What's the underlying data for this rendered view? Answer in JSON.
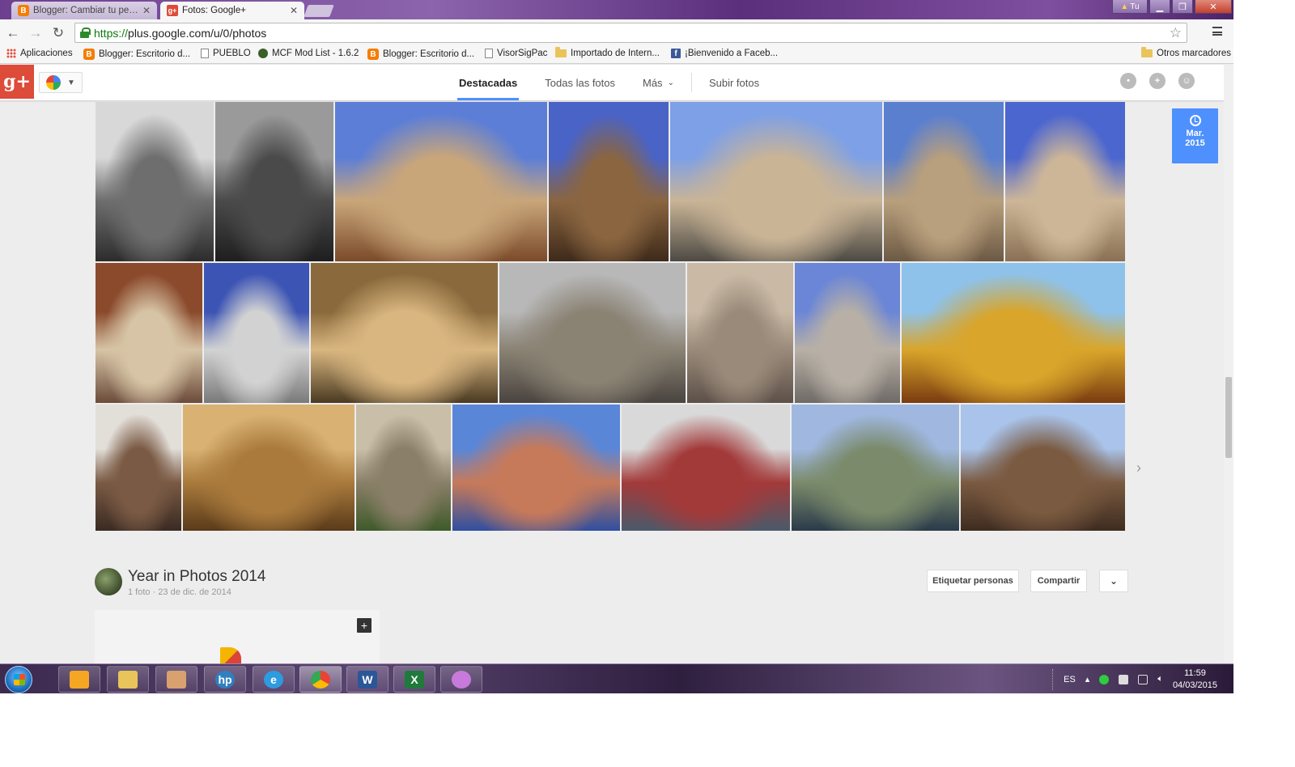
{
  "browser": {
    "tabs": [
      {
        "title": "Blogger: Cambiar tu perfil",
        "icon": "blogger-icon",
        "active": false
      },
      {
        "title": "Fotos: Google+",
        "icon": "google-plus-icon",
        "active": true
      }
    ],
    "window_user_label": "Tu",
    "url_scheme": "https://",
    "url_rest": "plus.google.com/u/0/photos",
    "bookmarks": [
      {
        "label": "Aplicaciones",
        "icon": "apps-icon"
      },
      {
        "label": "Blogger: Escritorio d...",
        "icon": "blogger-icon"
      },
      {
        "label": "PUEBLO",
        "icon": "page-icon"
      },
      {
        "label": "MCF Mod List - 1.6.2",
        "icon": "mcf-icon"
      },
      {
        "label": "Blogger: Escritorio d...",
        "icon": "blogger-icon"
      },
      {
        "label": "VisorSigPac",
        "icon": "page-icon"
      },
      {
        "label": "Importado de Intern...",
        "icon": "folder-icon"
      },
      {
        "label": "¡Bienvenido a Faceb...",
        "icon": "facebook-icon"
      }
    ],
    "other_bookmarks": "Otros marcadores"
  },
  "gplus": {
    "logo": "g+",
    "nav": [
      "Destacadas",
      "Todas las fotos",
      "Más"
    ],
    "upload": "Subir fotos",
    "selected_nav": "Destacadas"
  },
  "date_badge": {
    "month": "Mar.",
    "year": "2015"
  },
  "photos": [
    {
      "subject": "stone column",
      "colors": [
        "#d8d8d8",
        "#6e6e6e",
        "#2c2c2c"
      ]
    },
    {
      "subject": "church tower bw",
      "colors": [
        "#9a9a9a",
        "#4a4a4a",
        "#1e1e1e"
      ]
    },
    {
      "subject": "town hall clock",
      "colors": [
        "#5d7ed6",
        "#c9a67a",
        "#7b4a2a"
      ]
    },
    {
      "subject": "bell tower",
      "colors": [
        "#4a63c7",
        "#8a6540",
        "#3e2a1a"
      ]
    },
    {
      "subject": "church plaza",
      "colors": [
        "#7ea0e6",
        "#c9b496",
        "#4d4a44"
      ]
    },
    {
      "subject": "stone house",
      "colors": [
        "#5a7fcf",
        "#b89f7d",
        "#6d5a44"
      ]
    },
    {
      "subject": "belfry cross",
      "colors": [
        "#4c66cf",
        "#cdb698",
        "#8a7054"
      ]
    },
    {
      "subject": "tile mural",
      "colors": [
        "#8b4a2c",
        "#d7c4a6",
        "#6b4b3a"
      ]
    },
    {
      "subject": "stone finial",
      "colors": [
        "#3c54b4",
        "#d2d2d2",
        "#7a7a7a"
      ]
    },
    {
      "subject": "autumn plaza",
      "colors": [
        "#8a6a3c",
        "#d9b680",
        "#4a3a22"
      ]
    },
    {
      "subject": "old houses tree",
      "colors": [
        "#b8b8b8",
        "#8a8273",
        "#4a4440"
      ]
    },
    {
      "subject": "pillory base",
      "colors": [
        "#c9b9a5",
        "#9a8a7a",
        "#5c5048"
      ]
    },
    {
      "subject": "finial sky",
      "colors": [
        "#6b86d6",
        "#b8b0a6",
        "#6e6a66"
      ]
    },
    {
      "subject": "altar puzzle",
      "colors": [
        "#8ec2ea",
        "#d9a52a",
        "#7a3c10"
      ]
    },
    {
      "subject": "knight figurine",
      "colors": [
        "#e2ded8",
        "#7a5a44",
        "#3a2a22"
      ]
    },
    {
      "subject": "toledo sepia",
      "colors": [
        "#d9b273",
        "#a97a3c",
        "#5a3a1a"
      ]
    },
    {
      "subject": "stone cottage",
      "colors": [
        "#c9bfa8",
        "#8a7f68",
        "#3f5a2a"
      ]
    },
    {
      "subject": "riverside tower",
      "colors": [
        "#5a86d8",
        "#c77a5a",
        "#2f4fa0"
      ]
    },
    {
      "subject": "red bridge",
      "colors": [
        "#d9d9d9",
        "#a33a3a",
        "#4a5a6a"
      ]
    },
    {
      "subject": "roman bridge",
      "colors": [
        "#a0b8e0",
        "#7a8a6a",
        "#2a3a4a"
      ]
    },
    {
      "subject": "castle",
      "colors": [
        "#a9c3ea",
        "#7a5a40",
        "#3f2c20"
      ]
    }
  ],
  "album": {
    "title": "Year in Photos 2014",
    "count": "1 foto",
    "date": "23 de dic. de 2014",
    "tag_people": "Etiquetar personas",
    "share": "Compartir"
  },
  "taskbar": {
    "apps": [
      "media-player-icon",
      "file-explorer-icon",
      "network-icon",
      "hp-icon",
      "internet-explorer-icon",
      "chrome-icon",
      "word-icon",
      "excel-icon",
      "paint-icon"
    ],
    "lang": "ES",
    "time": "11:59",
    "date": "04/03/2015"
  }
}
